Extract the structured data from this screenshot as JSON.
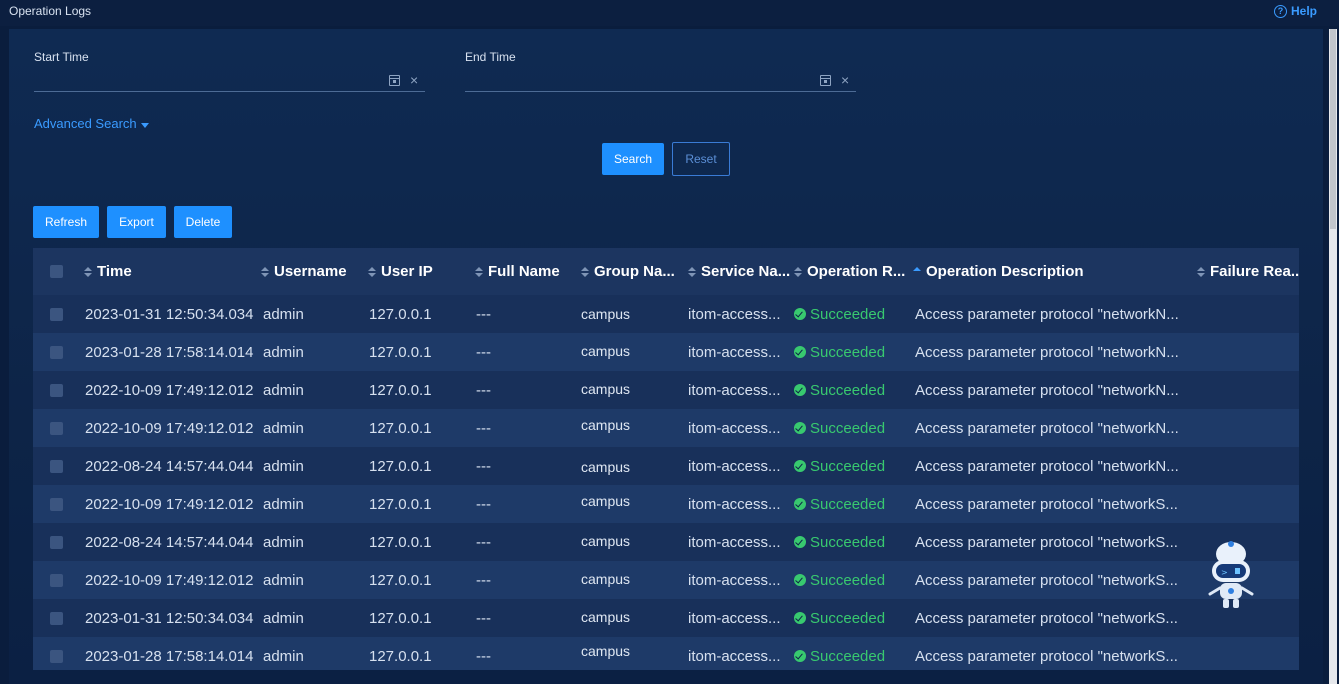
{
  "header": {
    "title": "Operation Logs",
    "help_label": "Help",
    "help_icon": "question-circle-icon"
  },
  "search": {
    "start_time_label": "Start Time",
    "start_time_value": "",
    "end_time_label": "End Time",
    "end_time_value": "",
    "advanced_search_label": "Advanced Search",
    "search_button": "Search",
    "reset_button": "Reset"
  },
  "toolbar": {
    "refresh_label": "Refresh",
    "export_label": "Export",
    "delete_label": "Delete"
  },
  "table": {
    "columns": [
      "Time",
      "Username",
      "User IP",
      "Full Name",
      "Group Na...",
      "Service Na...",
      "Operation R...",
      "Operation Description",
      "Failure Rea..."
    ],
    "sorted_column": "Operation Description",
    "rows": [
      {
        "time": "2023-01-31 12:50:34.034",
        "username": "admin",
        "ip": "127.0.0.1",
        "full_name": "---",
        "group": "campus",
        "service": "itom-access...",
        "result": "Succeeded",
        "description": "Access parameter protocol \"networkN...",
        "failure": ""
      },
      {
        "time": "2023-01-28 17:58:14.014",
        "username": "admin",
        "ip": "127.0.0.1",
        "full_name": "---",
        "group": "campus",
        "service": "itom-access...",
        "result": "Succeeded",
        "description": "Access parameter protocol \"networkN...",
        "failure": ""
      },
      {
        "time": "2022-10-09 17:49:12.012",
        "username": "admin",
        "ip": "127.0.0.1",
        "full_name": "---",
        "group": "campus",
        "service": "itom-access...",
        "result": "Succeeded",
        "description": "Access parameter protocol \"networkN...",
        "failure": ""
      },
      {
        "time": "2022-10-09 17:49:12.012",
        "username": "admin",
        "ip": "127.0.0.1",
        "full_name": "---",
        "group": "campus",
        "service": "itom-access...",
        "result": "Succeeded",
        "description": "Access parameter protocol \"networkN...",
        "failure": ""
      },
      {
        "time": "2022-08-24 14:57:44.044",
        "username": "admin",
        "ip": "127.0.0.1",
        "full_name": "---",
        "group": "campus",
        "service": "itom-access...",
        "result": "Succeeded",
        "description": "Access parameter protocol \"networkN...",
        "failure": ""
      },
      {
        "time": "2022-10-09 17:49:12.012",
        "username": "admin",
        "ip": "127.0.0.1",
        "full_name": "---",
        "group": "campus",
        "service": "itom-access...",
        "result": "Succeeded",
        "description": "Access parameter protocol \"networkS...",
        "failure": ""
      },
      {
        "time": "2022-08-24 14:57:44.044",
        "username": "admin",
        "ip": "127.0.0.1",
        "full_name": "---",
        "group": "campus",
        "service": "itom-access...",
        "result": "Succeeded",
        "description": "Access parameter protocol \"networkS...",
        "failure": ""
      },
      {
        "time": "2022-10-09 17:49:12.012",
        "username": "admin",
        "ip": "127.0.0.1",
        "full_name": "---",
        "group": "campus",
        "service": "itom-access...",
        "result": "Succeeded",
        "description": "Access parameter protocol \"networkS...",
        "failure": ""
      },
      {
        "time": "2023-01-31 12:50:34.034",
        "username": "admin",
        "ip": "127.0.0.1",
        "full_name": "---",
        "group": "campus",
        "service": "itom-access...",
        "result": "Succeeded",
        "description": "Access parameter protocol \"networkS...",
        "failure": ""
      },
      {
        "time": "2023-01-28 17:58:14.014",
        "username": "admin",
        "ip": "127.0.0.1",
        "full_name": "---",
        "group": "campus",
        "service": "itom-access...",
        "result": "Succeeded",
        "description": "Access parameter protocol \"networkS...",
        "failure": ""
      }
    ]
  },
  "assistant": {
    "icon": "robot-assistant-icon"
  },
  "colors": {
    "accent": "#1e90ff",
    "link": "#3a9bff",
    "success": "#38c96f",
    "background": "#0a1d3d"
  }
}
